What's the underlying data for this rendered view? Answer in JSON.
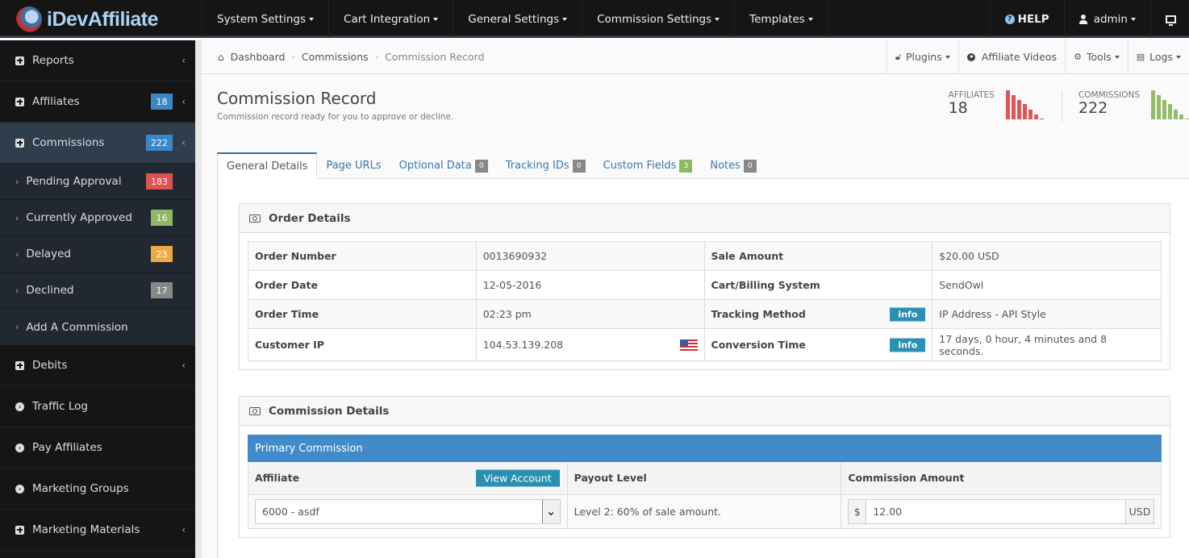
{
  "app": {
    "name": "iDevAffiliate"
  },
  "topnav": {
    "items": [
      {
        "label": "System Settings"
      },
      {
        "label": "Cart Integration"
      },
      {
        "label": "General Settings"
      },
      {
        "label": "Commission Settings"
      },
      {
        "label": "Templates"
      }
    ],
    "help_label": "HELP",
    "user_label": "admin",
    "icons": {
      "help": "question-circle-icon",
      "user": "user-icon",
      "screen": "monitor-icon"
    }
  },
  "sidebar": {
    "items": [
      {
        "label": "Reports",
        "icon": "plus-square-icon"
      },
      {
        "label": "Affiliates",
        "icon": "plus-square-icon",
        "badge": "18",
        "badge_color": "#3a87c8"
      },
      {
        "label": "Commissions",
        "icon": "plus-square-icon",
        "badge": "222",
        "badge_color": "#3a87c8"
      }
    ],
    "commission_sub": [
      {
        "label": "Pending Approval",
        "badge": "183",
        "badge_color": "#e05151"
      },
      {
        "label": "Currently Approved",
        "badge": "16",
        "badge_color": "#8fb864"
      },
      {
        "label": "Delayed",
        "badge": "23",
        "badge_color": "#efa944"
      },
      {
        "label": "Declined",
        "badge": "17",
        "badge_color": "#888888"
      },
      {
        "label": "Add A Commission"
      }
    ],
    "items_after": [
      {
        "label": "Debits",
        "icon": "plus-square-icon"
      },
      {
        "label": "Traffic Log",
        "icon": "chevron-circle-right-icon"
      },
      {
        "label": "Pay Affiliates",
        "icon": "chevron-circle-right-icon"
      },
      {
        "label": "Marketing Groups",
        "icon": "chevron-circle-right-icon"
      },
      {
        "label": "Marketing Materials",
        "icon": "plus-square-icon"
      }
    ]
  },
  "breadcrumb": {
    "items": [
      "Dashboard",
      "Commissions",
      "Commission Record"
    ]
  },
  "toolbar": {
    "plugins": "Plugins",
    "videos": "Affiliate Videos",
    "tools": "Tools",
    "logs": "Logs"
  },
  "page": {
    "title": "Commission Record",
    "subtitle": "Commission record ready for you to approve or decline."
  },
  "stats": {
    "affiliates": {
      "label": "AFFILIATES",
      "value": "18",
      "color": "#e05555",
      "bars": [
        1.0,
        0.83,
        0.66,
        0.52,
        0.34,
        0.17,
        0.03
      ]
    },
    "commissions": {
      "label": "COMMISSIONS",
      "value": "222",
      "color": "#95bb6c",
      "bars": [
        1.0,
        0.83,
        0.66,
        0.52,
        0.34,
        0.17,
        0.03
      ]
    }
  },
  "tabs": [
    {
      "label": "General Details",
      "active": true
    },
    {
      "label": "Page URLs"
    },
    {
      "label": "Optional Data",
      "badge": "0",
      "badge_color": "#888888"
    },
    {
      "label": "Tracking IDs",
      "badge": "0",
      "badge_color": "#888888"
    },
    {
      "label": "Custom Fields",
      "badge": "3",
      "badge_color": "#8fb864"
    },
    {
      "label": "Notes",
      "badge": "0",
      "badge_color": "#888888"
    }
  ],
  "order_details": {
    "title": "Order Details",
    "info_label": "info",
    "rows": [
      {
        "l1": "Order Number",
        "v1": "0013690932",
        "l2": "Sale Amount",
        "v2": "$20.00 USD"
      },
      {
        "l1": "Order Date",
        "v1": "12-05-2016",
        "l2": "Cart/Billing System",
        "v2": "SendOwl"
      },
      {
        "l1": "Order Time",
        "v1": "02:23 pm",
        "l2": "Tracking Method",
        "v2": "IP Address - API Style"
      },
      {
        "l1": "Customer IP",
        "v1": "104.53.139.208",
        "l2": "Conversion Time",
        "v2": "17 days, 0 hour, 4 minutes and 8 seconds."
      }
    ]
  },
  "commission_details": {
    "title": "Commission Details",
    "primary_label": "Primary Commission",
    "headers": {
      "affiliate": "Affiliate",
      "payout": "Payout Level",
      "amount": "Commission Amount"
    },
    "view_account": "View Account",
    "affiliate_value": "6000 - asdf",
    "payout_value": "Level 2: 60% of sale amount.",
    "currency_symbol": "$",
    "amount_value": "12.00",
    "currency": "USD"
  }
}
